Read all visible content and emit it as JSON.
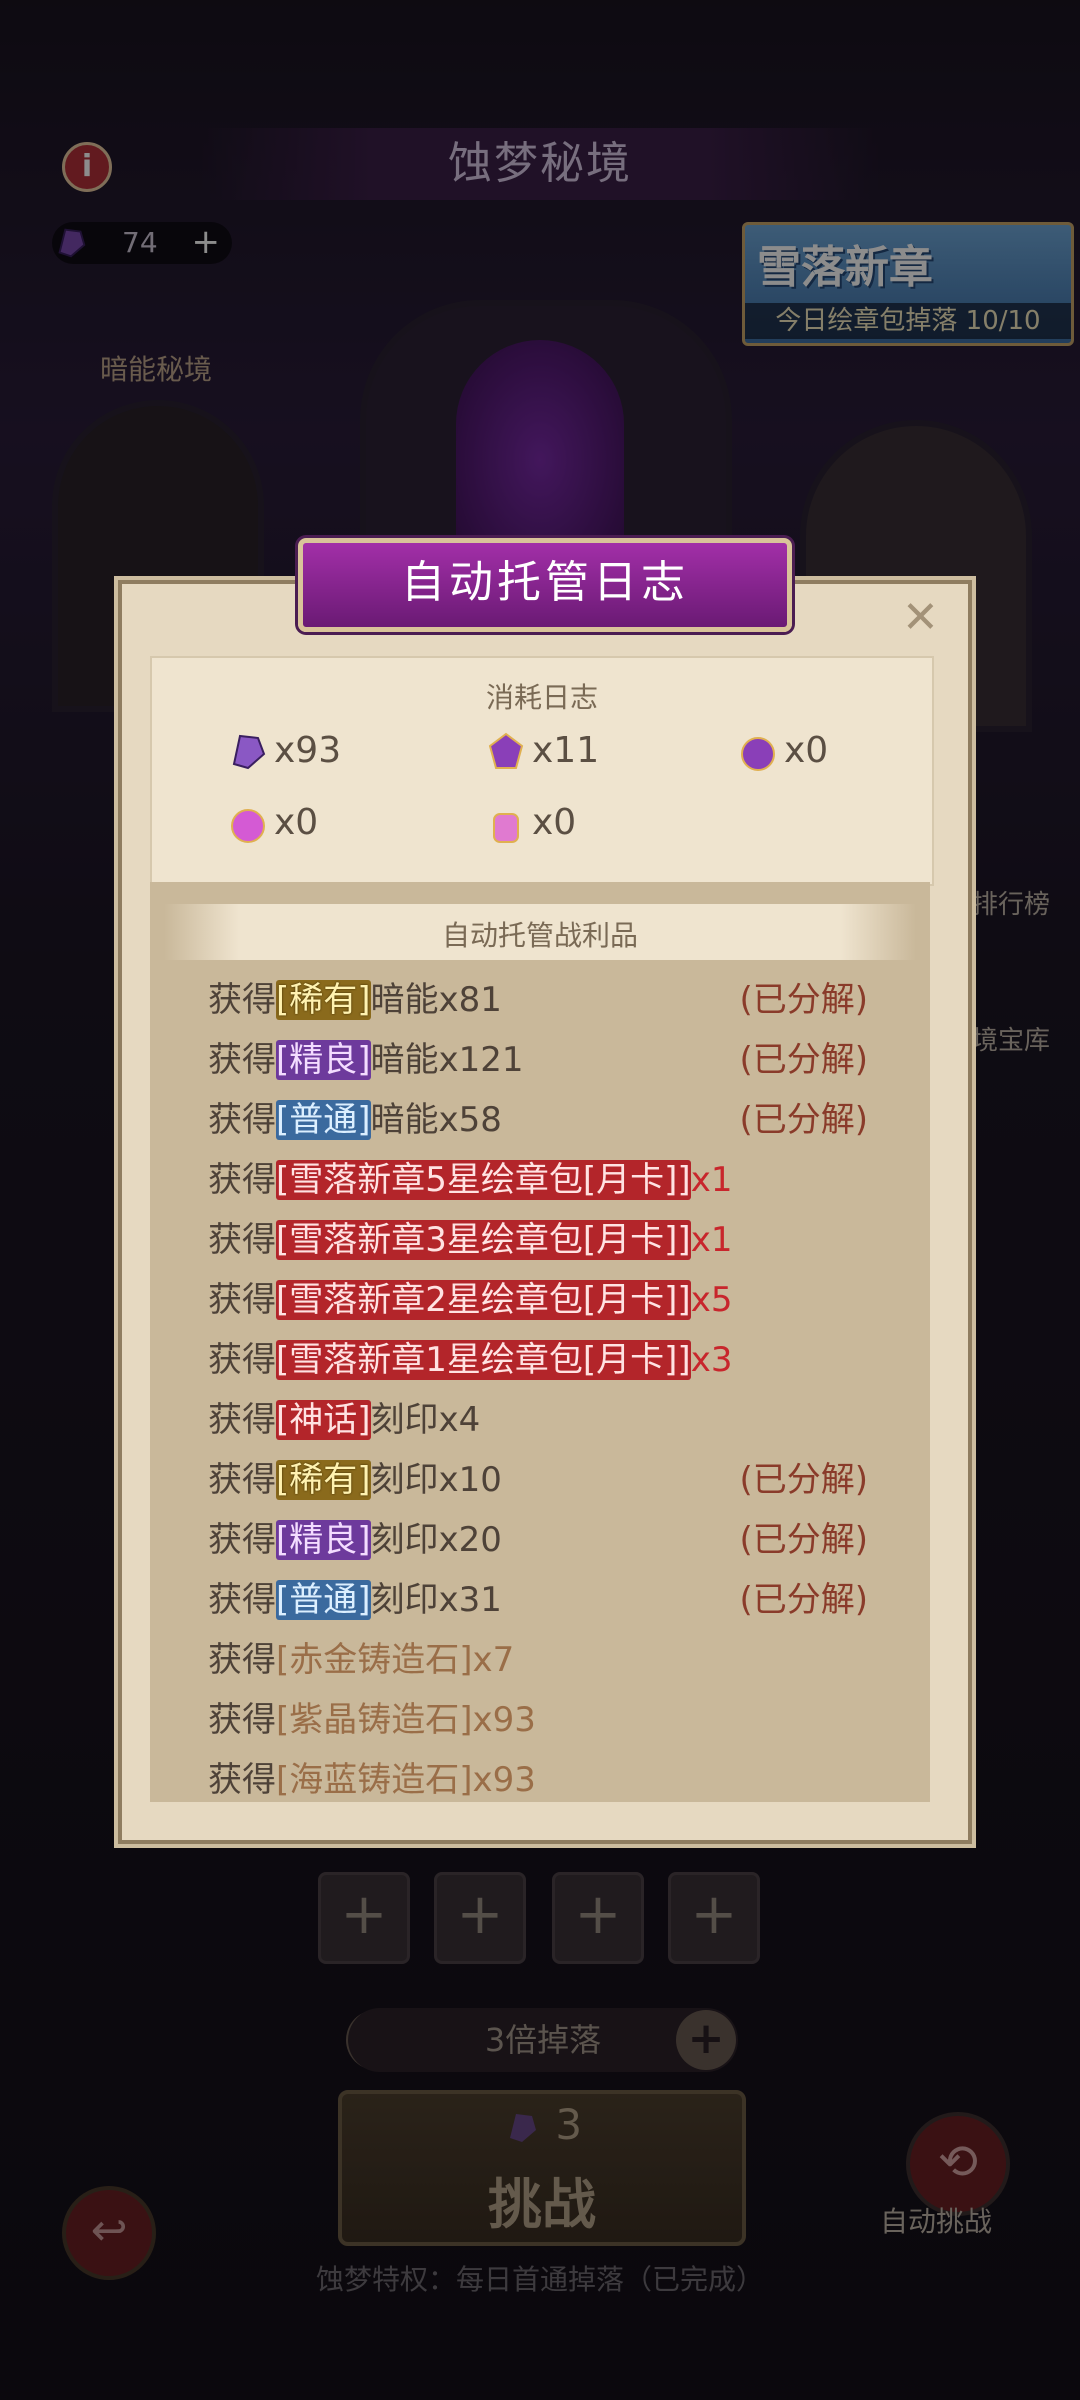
{
  "screen": {
    "title": "蚀梦秘境",
    "currency": {
      "icon": "dark-energy-gem-icon",
      "value": "74"
    },
    "event_banner": {
      "title": "雪落新章",
      "subtitle": "今日绘章包掉落 10/10"
    },
    "left_area_label": "暗能秘境",
    "side": {
      "rank_label": "排行榜",
      "vault_label": "境宝库"
    },
    "multiplier_label": "3倍掉落",
    "challenge": {
      "cost": "3",
      "label": "挑战"
    },
    "auto_label": "自动挑战",
    "privilege_text": "蚀梦特权：每日首通掉落（已完成）"
  },
  "dialog": {
    "title": "自动托管日志",
    "consumption_title": "消耗日志",
    "consumption": [
      {
        "icon": "dark-energy-gem-icon",
        "count": "x93"
      },
      {
        "icon": "purple-crest-icon",
        "count": "x11"
      },
      {
        "icon": "purple-orb-icon",
        "count": "x0"
      },
      {
        "icon": "pink-orb-icon",
        "count": "x0"
      },
      {
        "icon": "pink-jar-icon",
        "count": "x0"
      }
    ],
    "loot_title": "自动托管战利品",
    "loot": [
      {
        "obtain": "获得",
        "tag": "[稀有]",
        "item": "暗能x81",
        "status": "(已分解)",
        "tag_color": "#c9a227"
      },
      {
        "obtain": "获得",
        "tag": "[精良]",
        "item": "暗能x121",
        "status": "(已分解)",
        "tag_color": "#8a4cc4"
      },
      {
        "obtain": "获得",
        "tag": "[普通]",
        "item": "暗能x58",
        "status": "(已分解)",
        "tag_color": "#3b76b8"
      },
      {
        "obtain": "获得",
        "tag": "[雪落新章5星绘章包[月卡]]",
        "item": "x1",
        "status": ""
      },
      {
        "obtain": "获得",
        "tag": "[雪落新章3星绘章包[月卡]]",
        "item": "x1",
        "status": ""
      },
      {
        "obtain": "获得",
        "tag": "[雪落新章2星绘章包[月卡]]",
        "item": "x5",
        "status": ""
      },
      {
        "obtain": "获得",
        "tag": "[雪落新章1星绘章包[月卡]]",
        "item": "x3",
        "status": ""
      },
      {
        "obtain": "获得",
        "tag": "[神话]",
        "item": "刻印x4",
        "status": ""
      },
      {
        "obtain": "获得",
        "tag": "[稀有]",
        "item": "刻印x10",
        "status": "(已分解)"
      },
      {
        "obtain": "获得",
        "tag": "[精良]",
        "item": "刻印x20",
        "status": "(已分解)"
      },
      {
        "obtain": "获得",
        "tag": "[普通]",
        "item": "刻印x31",
        "status": "(已分解)"
      },
      {
        "obtain": "获得",
        "tag": "[赤金铸造石]",
        "item": "x7",
        "status": ""
      },
      {
        "obtain": "获得",
        "tag": "[紫晶铸造石]",
        "item": "x93",
        "status": ""
      },
      {
        "obtain": "获得",
        "tag": "[海蓝铸造石]",
        "item": "x93",
        "status": ""
      }
    ]
  }
}
